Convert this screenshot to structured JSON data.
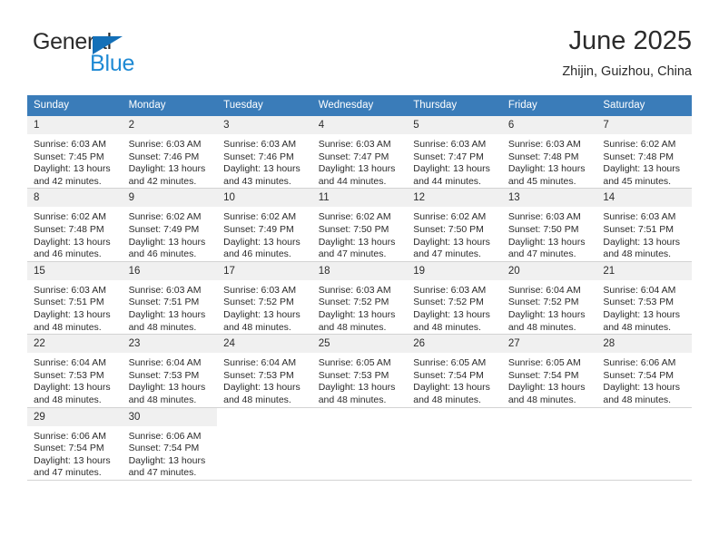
{
  "brand": {
    "name_part1": "General",
    "name_part2": "Blue",
    "triangle_icon": "triangle-icon",
    "accent_color": "#1f8ad4",
    "triangle_color": "#1470b8"
  },
  "header": {
    "title": "June 2025",
    "subtitle": "Zhijin, Guizhou, China"
  },
  "theme": {
    "header_bg": "#3a7cb9",
    "header_text": "#ffffff",
    "daynum_bg": "#f0f0f0",
    "row_divider": "#3a7cb9",
    "cell_divider": "#d3d3d3"
  },
  "calendar": {
    "weekdays": [
      "Sunday",
      "Monday",
      "Tuesday",
      "Wednesday",
      "Thursday",
      "Friday",
      "Saturday"
    ],
    "weeks": [
      [
        {
          "day": "1",
          "sunrise": "Sunrise: 6:03 AM",
          "sunset": "Sunset: 7:45 PM",
          "daylight_line1": "Daylight: 13 hours",
          "daylight_line2": "and 42 minutes."
        },
        {
          "day": "2",
          "sunrise": "Sunrise: 6:03 AM",
          "sunset": "Sunset: 7:46 PM",
          "daylight_line1": "Daylight: 13 hours",
          "daylight_line2": "and 42 minutes."
        },
        {
          "day": "3",
          "sunrise": "Sunrise: 6:03 AM",
          "sunset": "Sunset: 7:46 PM",
          "daylight_line1": "Daylight: 13 hours",
          "daylight_line2": "and 43 minutes."
        },
        {
          "day": "4",
          "sunrise": "Sunrise: 6:03 AM",
          "sunset": "Sunset: 7:47 PM",
          "daylight_line1": "Daylight: 13 hours",
          "daylight_line2": "and 44 minutes."
        },
        {
          "day": "5",
          "sunrise": "Sunrise: 6:03 AM",
          "sunset": "Sunset: 7:47 PM",
          "daylight_line1": "Daylight: 13 hours",
          "daylight_line2": "and 44 minutes."
        },
        {
          "day": "6",
          "sunrise": "Sunrise: 6:03 AM",
          "sunset": "Sunset: 7:48 PM",
          "daylight_line1": "Daylight: 13 hours",
          "daylight_line2": "and 45 minutes."
        },
        {
          "day": "7",
          "sunrise": "Sunrise: 6:02 AM",
          "sunset": "Sunset: 7:48 PM",
          "daylight_line1": "Daylight: 13 hours",
          "daylight_line2": "and 45 minutes."
        }
      ],
      [
        {
          "day": "8",
          "sunrise": "Sunrise: 6:02 AM",
          "sunset": "Sunset: 7:48 PM",
          "daylight_line1": "Daylight: 13 hours",
          "daylight_line2": "and 46 minutes."
        },
        {
          "day": "9",
          "sunrise": "Sunrise: 6:02 AM",
          "sunset": "Sunset: 7:49 PM",
          "daylight_line1": "Daylight: 13 hours",
          "daylight_line2": "and 46 minutes."
        },
        {
          "day": "10",
          "sunrise": "Sunrise: 6:02 AM",
          "sunset": "Sunset: 7:49 PM",
          "daylight_line1": "Daylight: 13 hours",
          "daylight_line2": "and 46 minutes."
        },
        {
          "day": "11",
          "sunrise": "Sunrise: 6:02 AM",
          "sunset": "Sunset: 7:50 PM",
          "daylight_line1": "Daylight: 13 hours",
          "daylight_line2": "and 47 minutes."
        },
        {
          "day": "12",
          "sunrise": "Sunrise: 6:02 AM",
          "sunset": "Sunset: 7:50 PM",
          "daylight_line1": "Daylight: 13 hours",
          "daylight_line2": "and 47 minutes."
        },
        {
          "day": "13",
          "sunrise": "Sunrise: 6:03 AM",
          "sunset": "Sunset: 7:50 PM",
          "daylight_line1": "Daylight: 13 hours",
          "daylight_line2": "and 47 minutes."
        },
        {
          "day": "14",
          "sunrise": "Sunrise: 6:03 AM",
          "sunset": "Sunset: 7:51 PM",
          "daylight_line1": "Daylight: 13 hours",
          "daylight_line2": "and 48 minutes."
        }
      ],
      [
        {
          "day": "15",
          "sunrise": "Sunrise: 6:03 AM",
          "sunset": "Sunset: 7:51 PM",
          "daylight_line1": "Daylight: 13 hours",
          "daylight_line2": "and 48 minutes."
        },
        {
          "day": "16",
          "sunrise": "Sunrise: 6:03 AM",
          "sunset": "Sunset: 7:51 PM",
          "daylight_line1": "Daylight: 13 hours",
          "daylight_line2": "and 48 minutes."
        },
        {
          "day": "17",
          "sunrise": "Sunrise: 6:03 AM",
          "sunset": "Sunset: 7:52 PM",
          "daylight_line1": "Daylight: 13 hours",
          "daylight_line2": "and 48 minutes."
        },
        {
          "day": "18",
          "sunrise": "Sunrise: 6:03 AM",
          "sunset": "Sunset: 7:52 PM",
          "daylight_line1": "Daylight: 13 hours",
          "daylight_line2": "and 48 minutes."
        },
        {
          "day": "19",
          "sunrise": "Sunrise: 6:03 AM",
          "sunset": "Sunset: 7:52 PM",
          "daylight_line1": "Daylight: 13 hours",
          "daylight_line2": "and 48 minutes."
        },
        {
          "day": "20",
          "sunrise": "Sunrise: 6:04 AM",
          "sunset": "Sunset: 7:52 PM",
          "daylight_line1": "Daylight: 13 hours",
          "daylight_line2": "and 48 minutes."
        },
        {
          "day": "21",
          "sunrise": "Sunrise: 6:04 AM",
          "sunset": "Sunset: 7:53 PM",
          "daylight_line1": "Daylight: 13 hours",
          "daylight_line2": "and 48 minutes."
        }
      ],
      [
        {
          "day": "22",
          "sunrise": "Sunrise: 6:04 AM",
          "sunset": "Sunset: 7:53 PM",
          "daylight_line1": "Daylight: 13 hours",
          "daylight_line2": "and 48 minutes."
        },
        {
          "day": "23",
          "sunrise": "Sunrise: 6:04 AM",
          "sunset": "Sunset: 7:53 PM",
          "daylight_line1": "Daylight: 13 hours",
          "daylight_line2": "and 48 minutes."
        },
        {
          "day": "24",
          "sunrise": "Sunrise: 6:04 AM",
          "sunset": "Sunset: 7:53 PM",
          "daylight_line1": "Daylight: 13 hours",
          "daylight_line2": "and 48 minutes."
        },
        {
          "day": "25",
          "sunrise": "Sunrise: 6:05 AM",
          "sunset": "Sunset: 7:53 PM",
          "daylight_line1": "Daylight: 13 hours",
          "daylight_line2": "and 48 minutes."
        },
        {
          "day": "26",
          "sunrise": "Sunrise: 6:05 AM",
          "sunset": "Sunset: 7:54 PM",
          "daylight_line1": "Daylight: 13 hours",
          "daylight_line2": "and 48 minutes."
        },
        {
          "day": "27",
          "sunrise": "Sunrise: 6:05 AM",
          "sunset": "Sunset: 7:54 PM",
          "daylight_line1": "Daylight: 13 hours",
          "daylight_line2": "and 48 minutes."
        },
        {
          "day": "28",
          "sunrise": "Sunrise: 6:06 AM",
          "sunset": "Sunset: 7:54 PM",
          "daylight_line1": "Daylight: 13 hours",
          "daylight_line2": "and 48 minutes."
        }
      ],
      [
        {
          "day": "29",
          "sunrise": "Sunrise: 6:06 AM",
          "sunset": "Sunset: 7:54 PM",
          "daylight_line1": "Daylight: 13 hours",
          "daylight_line2": "and 47 minutes."
        },
        {
          "day": "30",
          "sunrise": "Sunrise: 6:06 AM",
          "sunset": "Sunset: 7:54 PM",
          "daylight_line1": "Daylight: 13 hours",
          "daylight_line2": "and 47 minutes."
        },
        {
          "day": "",
          "sunrise": "",
          "sunset": "",
          "daylight_line1": "",
          "daylight_line2": ""
        },
        {
          "day": "",
          "sunrise": "",
          "sunset": "",
          "daylight_line1": "",
          "daylight_line2": ""
        },
        {
          "day": "",
          "sunrise": "",
          "sunset": "",
          "daylight_line1": "",
          "daylight_line2": ""
        },
        {
          "day": "",
          "sunrise": "",
          "sunset": "",
          "daylight_line1": "",
          "daylight_line2": ""
        },
        {
          "day": "",
          "sunrise": "",
          "sunset": "",
          "daylight_line1": "",
          "daylight_line2": ""
        }
      ]
    ]
  }
}
